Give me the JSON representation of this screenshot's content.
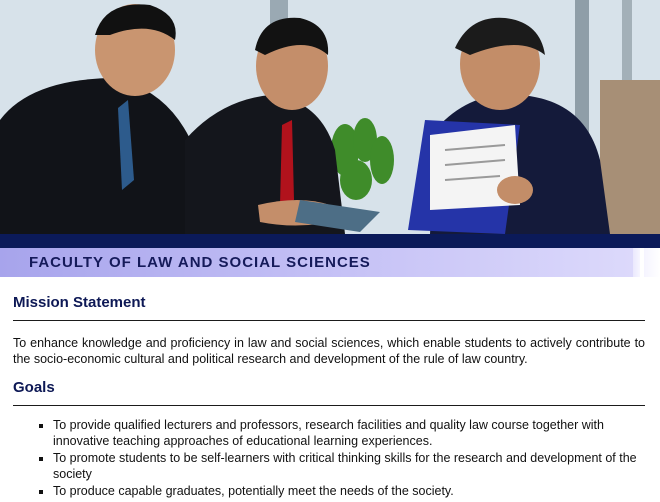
{
  "hero": {
    "image_alt": "Three businessmen in suits reviewing documents"
  },
  "page": {
    "title": "FACULTY OF LAW AND SOCIAL SCIENCES"
  },
  "mission": {
    "heading": "Mission Statement",
    "text": "To enhance knowledge and proficiency in law and social sciences, which enable students to actively contribute to the socio-economic cultural and political research and development of the rule of law country."
  },
  "goals": {
    "heading": "Goals",
    "items": [
      "To provide qualified lecturers and professors, research facilities and quality law course together with innovative teaching approaches of educational learning experiences.",
      "To promote students to be self-learners with critical thinking skills for the research and development of the society",
      "To produce capable graduates, potentially meet the needs of the society."
    ]
  },
  "colors": {
    "navy_strip": "#0b1a59",
    "title_bar": "#b7b3f2",
    "heading_text": "#0d1855"
  }
}
